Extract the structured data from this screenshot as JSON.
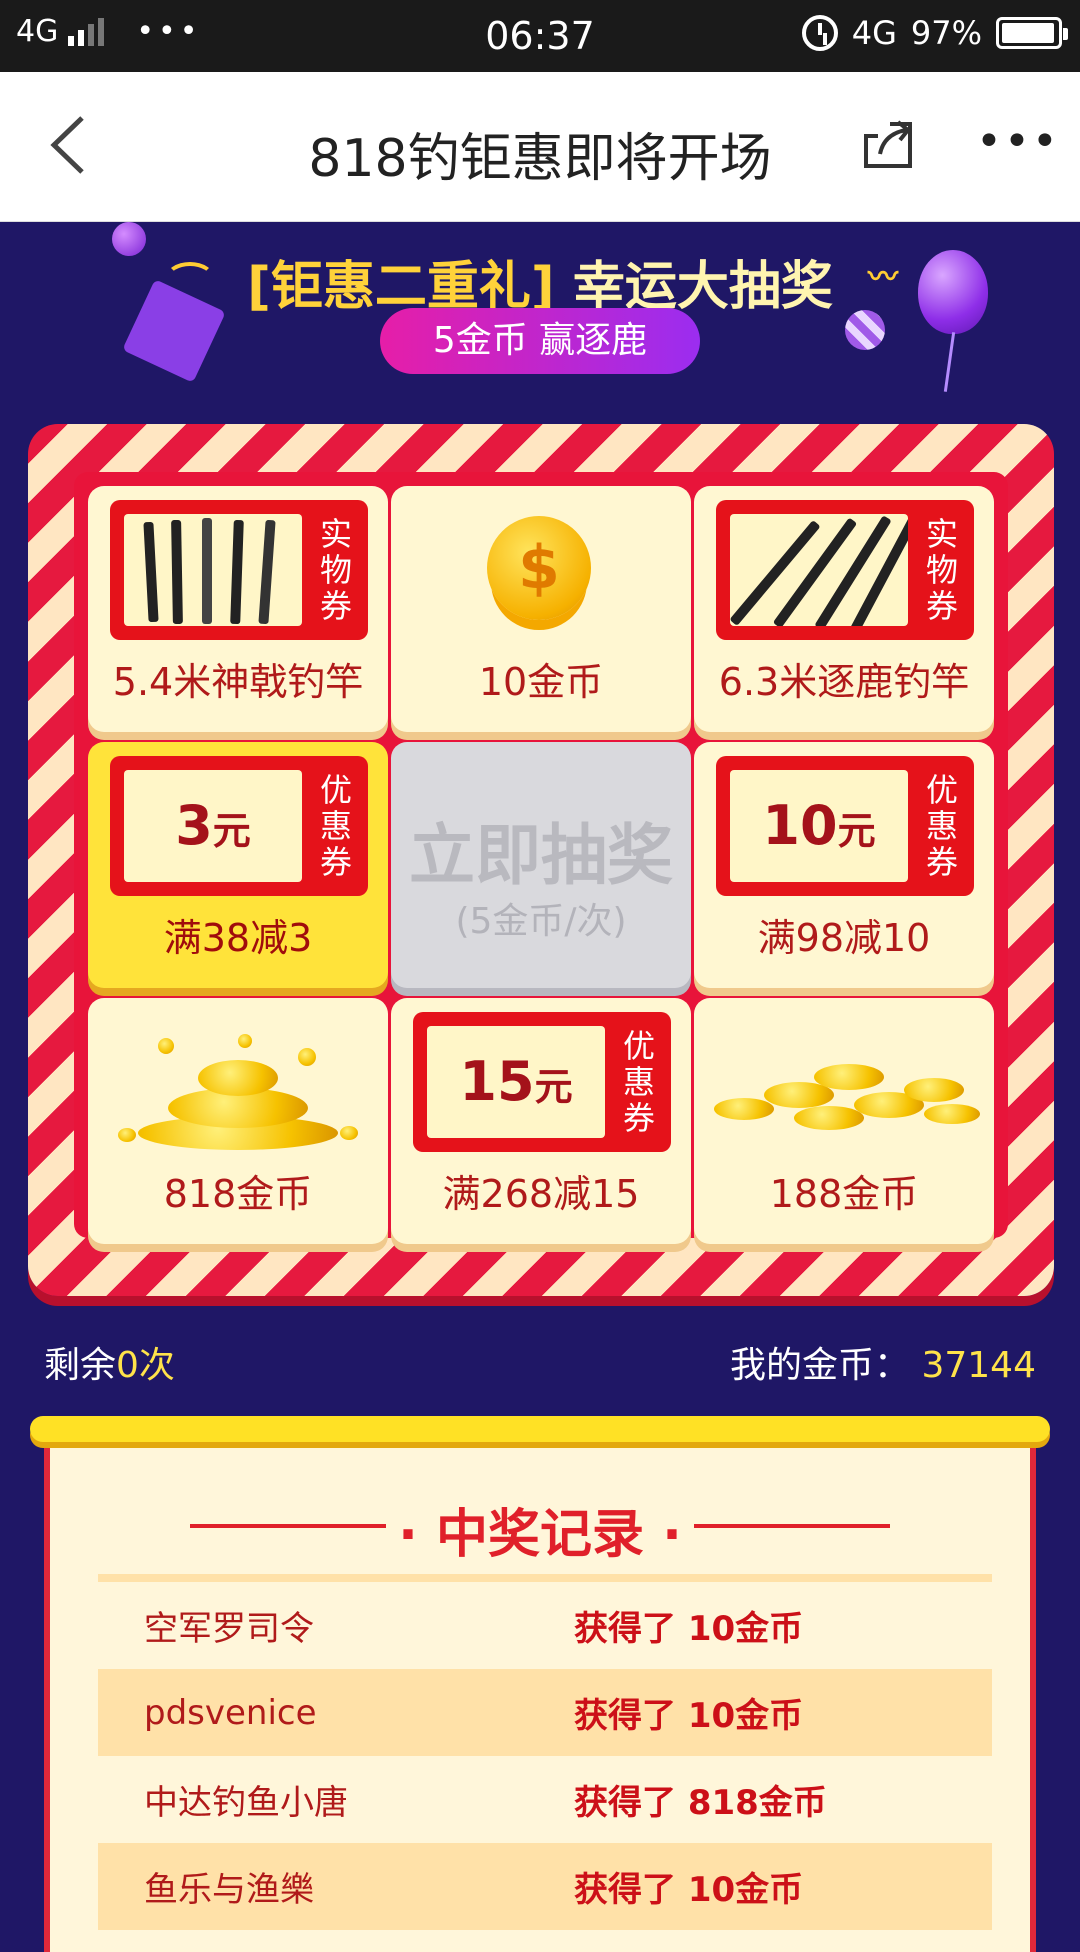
{
  "status_bar": {
    "network": "4G",
    "time": "06:37",
    "network_right": "4G",
    "battery": "97%",
    "battery_level": 0.97
  },
  "nav": {
    "title": "818钓钜惠即将开场"
  },
  "banner": {
    "title_bracket": "[钜惠二重礼]",
    "title_main": "幸运大抽奖",
    "subtitle": "5金币 赢逐鹿"
  },
  "grid": {
    "cells": [
      {
        "label": "5.4米神戟钓竿",
        "type": "coupon-rods",
        "tag": "实物券"
      },
      {
        "label": "10金币",
        "type": "coin"
      },
      {
        "label": "6.3米逐鹿钓竿",
        "type": "coupon-rods",
        "tag": "实物券"
      },
      {
        "label": "满38减3",
        "type": "coupon",
        "amount": "3",
        "unit": "元",
        "tag": "优惠券",
        "active": true
      },
      {
        "label": "满98减10",
        "type": "coupon",
        "amount": "10",
        "unit": "元",
        "tag": "优惠券"
      },
      {
        "label": "818金币",
        "type": "coin-pile"
      },
      {
        "label": "满268减15",
        "type": "coupon",
        "amount": "15",
        "unit": "元",
        "tag": "优惠券"
      },
      {
        "label": "188金币",
        "type": "coin-pile"
      }
    ],
    "draw_button": "立即抽奖",
    "draw_cost": "(5金币/次)"
  },
  "info": {
    "remaining_prefix": "剩余",
    "remaining_count": "0次",
    "coins_label": "我的金币：",
    "coins_value": "37144"
  },
  "records": {
    "title": "· 中奖记录 ·",
    "rows": [
      {
        "name": "空军罗司令",
        "prize": "获得了 10金币"
      },
      {
        "name": "pdsvenice",
        "prize": "获得了 10金币"
      },
      {
        "name": "中达钓鱼小唐",
        "prize": "获得了 818金币"
      },
      {
        "name": "鱼乐与渔樂",
        "prize": "获得了 10金币"
      }
    ]
  },
  "colors": {
    "background": "#1f1766",
    "accent_red": "#e0202a",
    "highlight_yellow": "#ffe34a"
  }
}
